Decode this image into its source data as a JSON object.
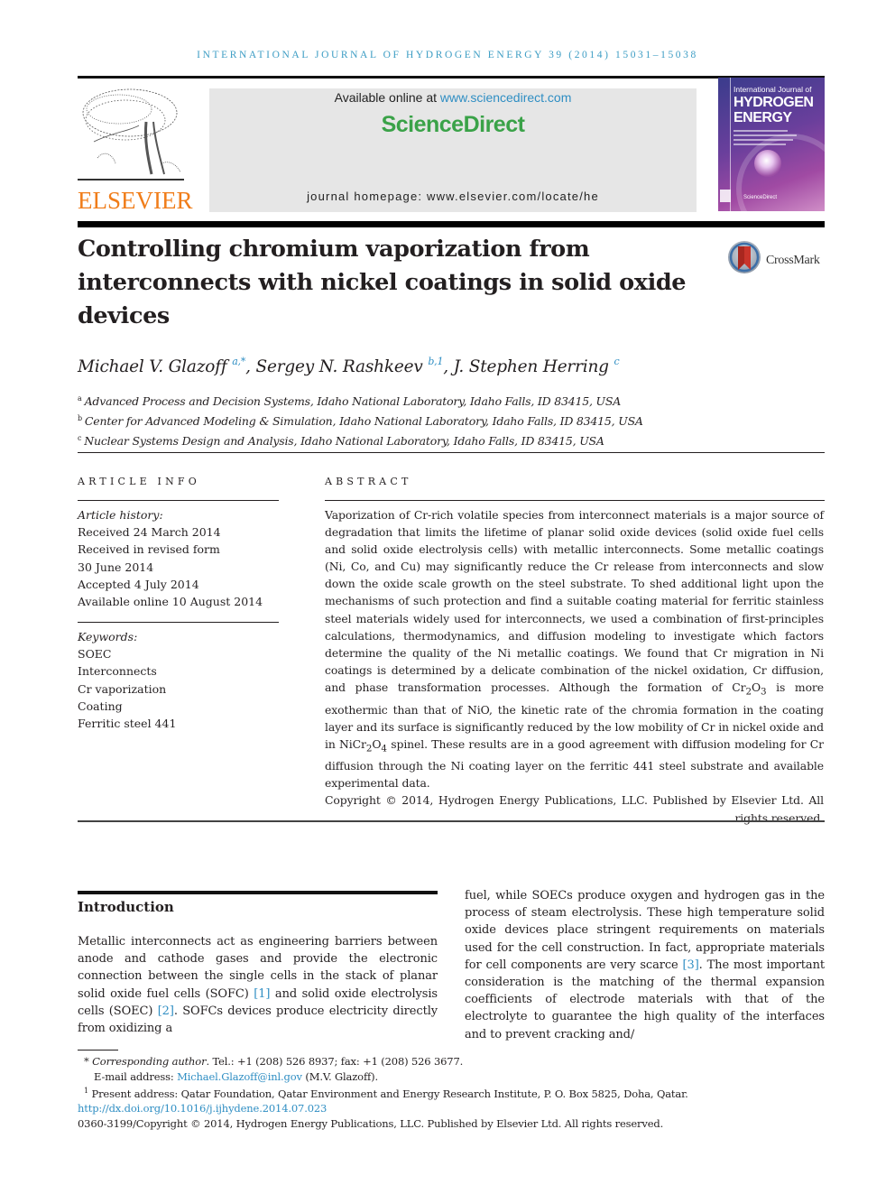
{
  "running_head": "INTERNATIONAL JOURNAL OF HYDROGEN ENERGY 39 (2014) 15031–15038",
  "header": {
    "publisher_logo_text": "ELSEVIER",
    "available_online_prefix": "Available online at ",
    "available_online_link": "www.sciencedirect.com",
    "brand": "ScienceDirect",
    "homepage_label": "journal homepage: www.elsevier.com/locate/he",
    "cover": {
      "line1": "International Journal of",
      "line2": "HYDROGEN",
      "line3": "ENERGY",
      "footer": "ScienceDirect"
    },
    "colors": {
      "accent_blue": "#2f8ec3",
      "elsevier_orange": "#f07d1a",
      "sciencedirect_green": "#3aa248"
    }
  },
  "article": {
    "title": "Controlling chromium vaporization from interconnects with nickel coatings in solid oxide devices",
    "crossmark_label": "CrossMark",
    "authors": [
      {
        "name": "Michael V. Glazoff",
        "marks": "a,*"
      },
      {
        "name": "Sergey N. Rashkeev",
        "marks": "b,1"
      },
      {
        "name": "J. Stephen Herring",
        "marks": "c"
      }
    ],
    "affiliations": [
      {
        "mark": "a",
        "text": "Advanced Process and Decision Systems, Idaho National Laboratory, Idaho Falls, ID 83415, USA"
      },
      {
        "mark": "b",
        "text": "Center for Advanced Modeling & Simulation, Idaho National Laboratory, Idaho Falls, ID 83415, USA"
      },
      {
        "mark": "c",
        "text": "Nuclear Systems Design and Analysis, Idaho National Laboratory, Idaho Falls, ID 83415, USA"
      }
    ]
  },
  "article_info": {
    "heading": "ARTICLE INFO",
    "history_label": "Article history:",
    "history": [
      "Received 24 March 2014",
      "Received in revised form",
      "30 June 2014",
      "Accepted 4 July 2014",
      "Available online 10 August 2014"
    ],
    "keywords_label": "Keywords:",
    "keywords": [
      "SOEC",
      "Interconnects",
      "Cr vaporization",
      "Coating",
      "Ferritic steel 441"
    ]
  },
  "abstract": {
    "heading": "ABSTRACT",
    "part1": "Vaporization of Cr-rich volatile species from interconnect materials is a major source of degradation that limits the lifetime of planar solid oxide devices (solid oxide fuel cells and solid oxide electrolysis cells) with metallic interconnects. Some metallic coatings (Ni, Co, and Cu) may significantly reduce the Cr release from interconnects and slow down the oxide scale growth on the steel substrate. To shed additional light upon the mechanisms of such protection and find a suitable coating material for ferritic stainless steel materials widely used for interconnects, we used a combination of first-principles calculations, thermodynamics, and diffusion modeling to investigate which factors determine the quality of the Ni metallic coatings. We found that Cr migration in Ni coatings is determined by a delicate combination of the nickel oxidation, Cr diffusion, and phase transformation processes. Although the formation of Cr",
    "sub1": "2",
    "part2": "O",
    "sub2": "3",
    "part3": " is more exothermic than that of NiO, the kinetic rate of the chromia formation in the coating layer and its surface is significantly reduced by the low mobility of Cr in nickel oxide and in NiCr",
    "sub3": "2",
    "part4": "O",
    "sub4": "4",
    "part5": " spinel. These results are in a good agreement with diffusion modeling for Cr diffusion through the Ni coating layer on the ferritic 441 steel substrate and available experimental data.",
    "copyright": "Copyright © 2014, Hydrogen Energy Publications, LLC. Published by Elsevier Ltd. All rights reserved."
  },
  "introduction": {
    "heading": "Introduction",
    "left": {
      "t1": "Metallic interconnects act as engineering barriers between anode and cathode gases and provide the electronic connection between the single cells in the stack of planar solid oxide fuel cells (SOFC) ",
      "r1": "[1]",
      "t2": " and solid oxide electrolysis cells (SOEC) ",
      "r2": "[2]",
      "t3": ". SOFCs devices produce electricity directly from oxidizing a"
    },
    "right": {
      "t1": "fuel, while SOECs produce oxygen and hydrogen gas in the process of steam electrolysis. These high temperature solid oxide devices place stringent requirements on materials used for the cell construction. In fact, appropriate materials for cell components are very scarce ",
      "r1": "[3]",
      "t2": ". The most important consideration is the matching of the thermal expansion coefficients of electrode materials with that of the electrolyte to guarantee the high quality of the interfaces and to prevent cracking and/"
    }
  },
  "footnotes": {
    "corr_mark": "*",
    "corr_label": "Corresponding author",
    "corr_text": ". Tel.: +1 (208) 526 8937; fax: +1 (208) 526 3677.",
    "email_label": "E-mail address: ",
    "email": "Michael.Glazoff@inl.gov",
    "email_suffix": " (M.V. Glazoff).",
    "note1_mark": "1",
    "note1_text": "Present address: Qatar Foundation, Qatar Environment and Energy Research Institute, P. O. Box 5825, Doha, Qatar.",
    "doi": "http://dx.doi.org/10.1016/j.ijhydene.2014.07.023",
    "issn_copyright": "0360-3199/Copyright © 2014, Hydrogen Energy Publications, LLC. Published by Elsevier Ltd. All rights reserved."
  }
}
